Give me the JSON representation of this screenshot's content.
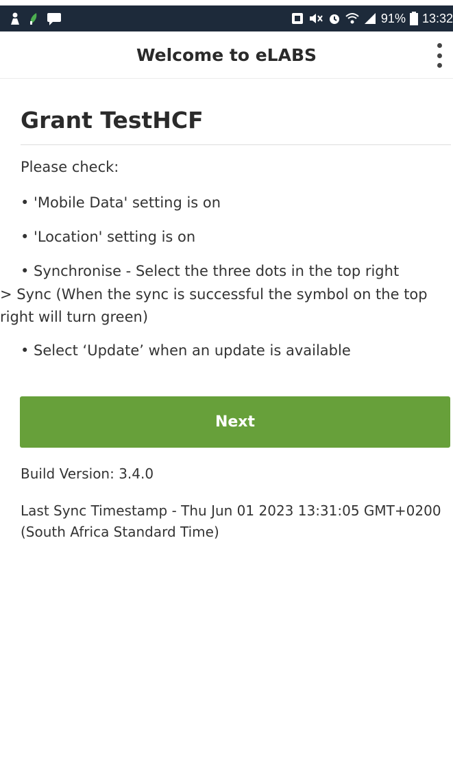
{
  "status_bar": {
    "battery_text": "91%",
    "time": "13:32",
    "left_icons": [
      "person-icon",
      "leaf-icon",
      "chat-icon"
    ],
    "right_icons": [
      "nfc-icon",
      "mute-icon",
      "alarm-icon",
      "wifi-icon",
      "signal-icon",
      "battery-icon"
    ]
  },
  "app_bar": {
    "title": "Welcome to eLABS",
    "menu_icon": "more-vert-icon"
  },
  "main": {
    "user_name": "Grant TestHCF",
    "check_heading": "Please check:",
    "bullets": [
      "• 'Mobile Data' setting is on",
      "• 'Location' setting is on",
      "• Synchronise - Select the three dots in the top right",
      "• Select ‘Update’ when an update is available"
    ],
    "sync_continuation": "> Sync (When the sync is successful the symbol on the top right will turn green)",
    "next_label": "Next",
    "build_version": "Build Version: 3.4.0",
    "last_sync": "Last Sync Timestamp - Thu Jun 01 2023 13:31:05 GMT+0200 (South Africa Standard Time)"
  },
  "colors": {
    "status_bar_bg": "#1d2a3a",
    "accent_green": "#67a03a",
    "text": "#333333"
  }
}
